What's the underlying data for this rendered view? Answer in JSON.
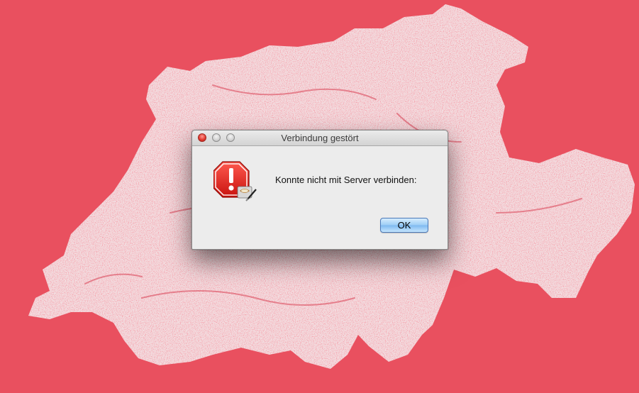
{
  "desktop": {
    "background_color": "#e9505f",
    "map_color": "#f3dde0"
  },
  "dialog": {
    "title": "Verbindung gestört",
    "message": "Konnte nicht mit Server verbinden:",
    "icon": "stop-alert-icon",
    "ok_label": "OK",
    "window_controls": [
      "close",
      "minimize",
      "zoom"
    ]
  }
}
